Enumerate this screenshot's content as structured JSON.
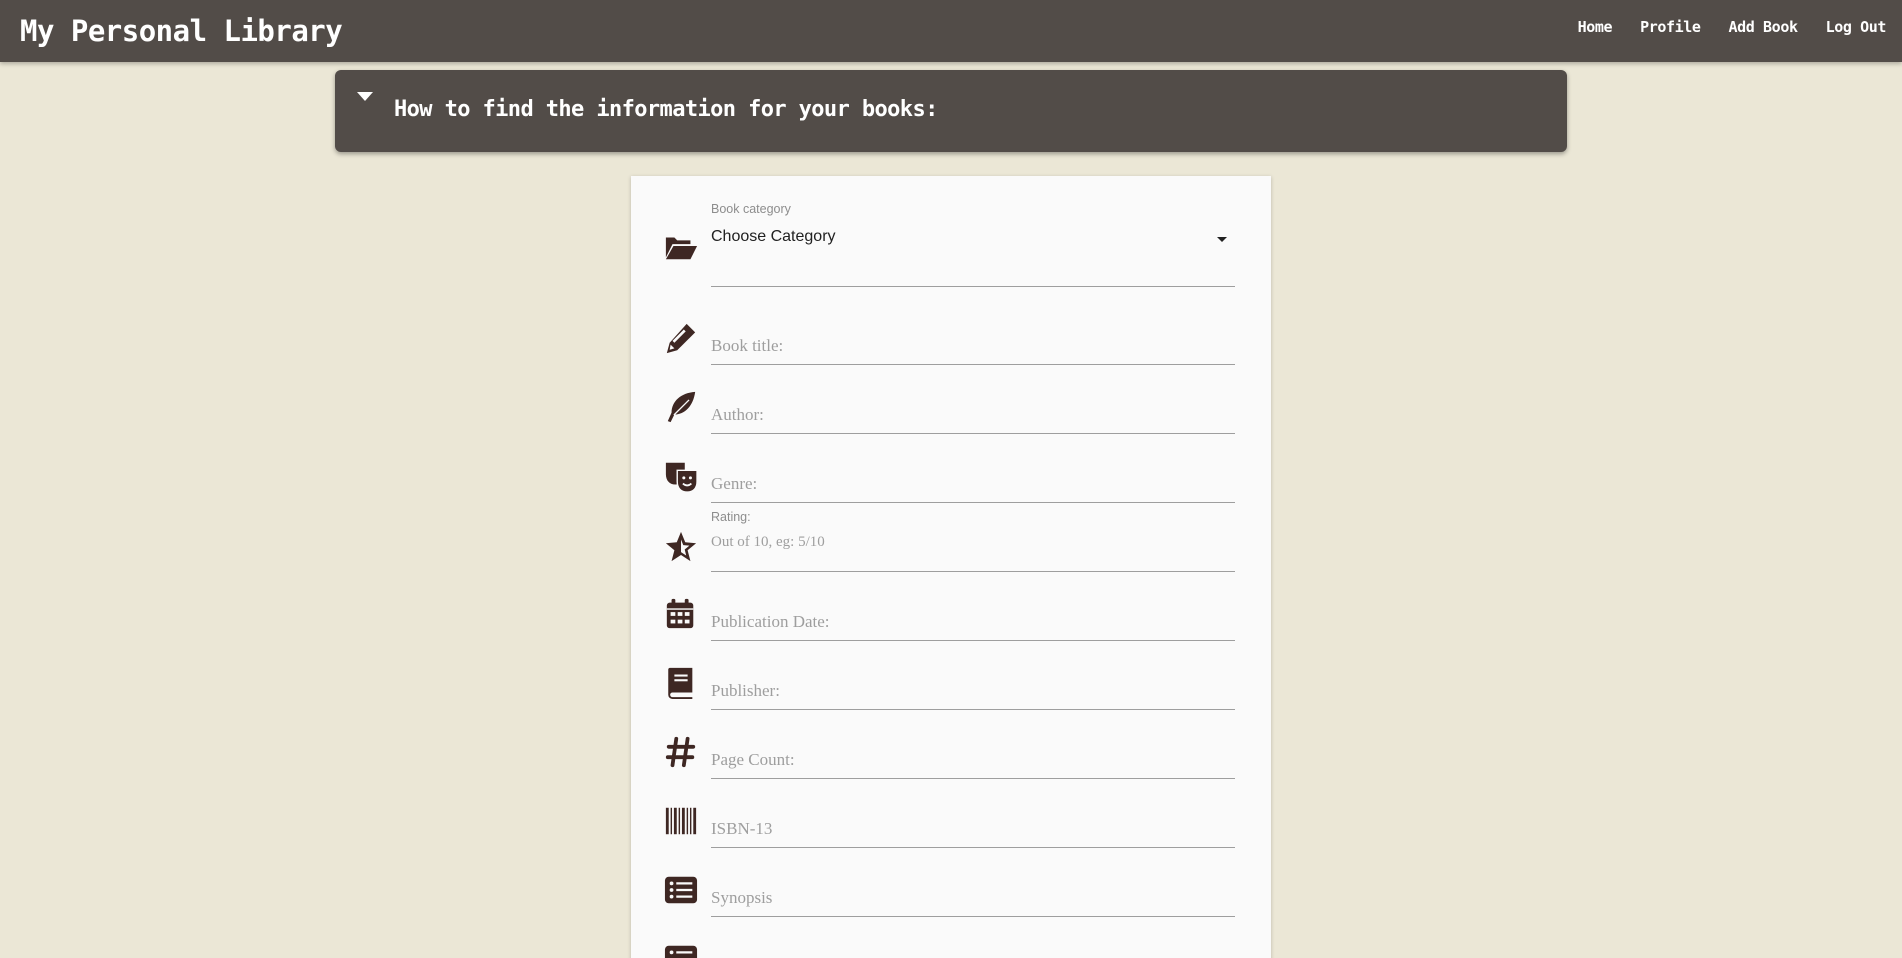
{
  "navbar": {
    "brand": "My Personal Library",
    "links": [
      "Home",
      "Profile",
      "Add Book",
      "Log Out"
    ]
  },
  "help": {
    "title": "How to find the information for your books:",
    "icon": "caret-down-icon"
  },
  "form": {
    "category": {
      "label": "Book category",
      "selected": "Choose Category",
      "icon": "folder-open-icon"
    },
    "fields": [
      {
        "key": "title",
        "placeholder": "Book title:",
        "icon": "pencil-icon"
      },
      {
        "key": "author",
        "placeholder": "Author:",
        "icon": "feather-icon"
      },
      {
        "key": "genre",
        "placeholder": "Genre:",
        "icon": "theater-masks-icon"
      },
      {
        "key": "rating",
        "label": "Rating:",
        "placeholder": "Out of 10, eg: 5/10",
        "icon": "star-icon"
      },
      {
        "key": "publication_date",
        "placeholder": "Publication Date:",
        "icon": "calendar-icon"
      },
      {
        "key": "publisher",
        "placeholder": "Publisher:",
        "icon": "book-icon"
      },
      {
        "key": "page_count",
        "placeholder": "Page Count:",
        "icon": "hashtag-icon"
      },
      {
        "key": "isbn",
        "placeholder": "ISBN-13",
        "icon": "barcode-icon"
      },
      {
        "key": "synopsis",
        "placeholder": "Synopsis",
        "icon": "list-icon"
      }
    ]
  },
  "colors": {
    "background": "#ebe7d6",
    "navbar": "#524c48",
    "card": "#fafafa",
    "icon": "#3e2723"
  }
}
